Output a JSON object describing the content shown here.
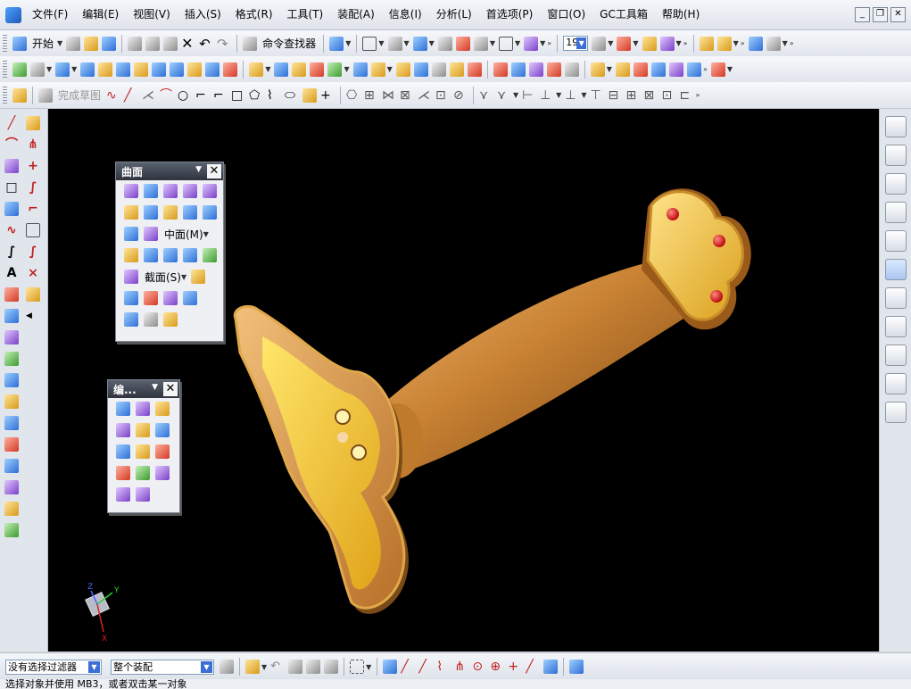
{
  "menubar": {
    "items": [
      "文件(F)",
      "编辑(E)",
      "视图(V)",
      "插入(S)",
      "格式(R)",
      "工具(T)",
      "装配(A)",
      "信息(I)",
      "分析(L)",
      "首选项(P)",
      "窗口(O)",
      "GC工具箱",
      "帮助(H)"
    ]
  },
  "toolbar1": {
    "start_label": "开始",
    "command_finder_label": "命令查找器",
    "layer_value": "19"
  },
  "toolbar3": {
    "finish_sketch_label": "完成草图"
  },
  "surface_palette": {
    "title": "曲面",
    "mid_surface_label": "中面(M)",
    "section_label": "截面(S)"
  },
  "edit_palette": {
    "title": "编..."
  },
  "statusbar": {
    "filter_value": "没有选择过滤器",
    "assembly_value": "整个装配"
  },
  "prompt": {
    "text": "选择对象并使用 MB3，或者双击某一对象"
  },
  "axis_triad": {
    "x_label": "X",
    "y_label": "Y",
    "z_label": "Z"
  }
}
